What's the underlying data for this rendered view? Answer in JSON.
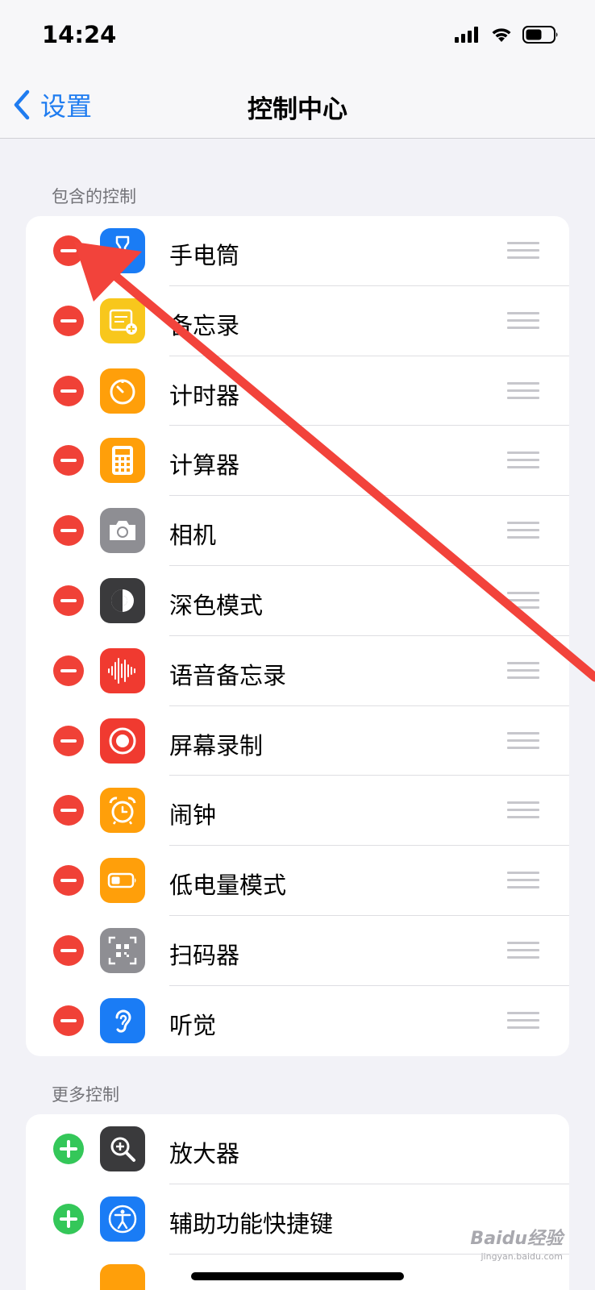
{
  "status_bar": {
    "time": "14:24"
  },
  "nav": {
    "back_label": "设置",
    "title": "控制中心"
  },
  "included": {
    "header": "包含的控制",
    "items": [
      {
        "label": "手电筒",
        "icon": "flashlight-icon",
        "color": "#1a7cf5"
      },
      {
        "label": "备忘录",
        "icon": "notes-icon",
        "color": "#f8c71c"
      },
      {
        "label": "计时器",
        "icon": "timer-icon",
        "color": "#ff9f0a"
      },
      {
        "label": "计算器",
        "icon": "calculator-icon",
        "color": "#ff9f0a"
      },
      {
        "label": "相机",
        "icon": "camera-icon",
        "color": "#8e8e93"
      },
      {
        "label": "深色模式",
        "icon": "dark-mode-icon",
        "color": "#3a3a3c"
      },
      {
        "label": "语音备忘录",
        "icon": "voice-memo-icon",
        "color": "#f03a30"
      },
      {
        "label": "屏幕录制",
        "icon": "screen-record-icon",
        "color": "#f03a30"
      },
      {
        "label": "闹钟",
        "icon": "alarm-icon",
        "color": "#ff9f0a"
      },
      {
        "label": "低电量模式",
        "icon": "low-power-icon",
        "color": "#ff9f0a"
      },
      {
        "label": "扫码器",
        "icon": "qr-scanner-icon",
        "color": "#8e8e93"
      },
      {
        "label": "听觉",
        "icon": "hearing-icon",
        "color": "#1a7cf5"
      }
    ]
  },
  "more": {
    "header": "更多控制",
    "items": [
      {
        "label": "放大器",
        "icon": "magnifier-icon",
        "color": "#3a3a3c"
      },
      {
        "label": "辅助功能快捷键",
        "icon": "accessibility-icon",
        "color": "#1a7cf5"
      }
    ]
  },
  "watermark": {
    "brand": "Baidu经验",
    "url": "jingyan.baidu.com"
  },
  "colors": {
    "accent": "#1f7cf0",
    "remove": "#f04137",
    "add": "#34c759",
    "annotation_arrow": "#f2433b"
  }
}
